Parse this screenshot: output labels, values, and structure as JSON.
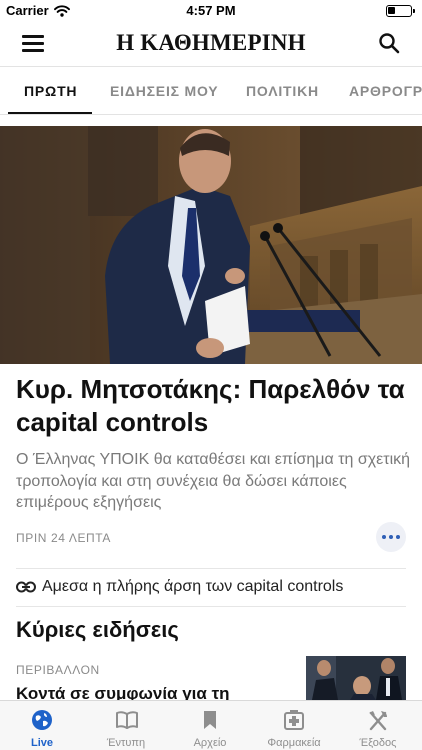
{
  "status_bar": {
    "carrier": "Carrier",
    "time": "4:57 PM"
  },
  "header": {
    "masthead": "Η ΚΑΘΗΜΕΡΙΝΗ",
    "menu_icon": "hamburger-menu-icon",
    "search_icon": "search-icon"
  },
  "tabs": [
    {
      "label": "ΠΡΩΤΗ",
      "active": true
    },
    {
      "label": "ΕΙΔΗΣΕΙΣ ΜΟΥ",
      "active": false
    },
    {
      "label": "ΠΟΛΙΤΙΚΗ",
      "active": false
    },
    {
      "label": "ΑΡΘΡΟΓΡΑΦΙΑ",
      "active": false
    }
  ],
  "lead_story": {
    "headline": "Κυρ. Μητσοτάκης: Παρελθόν τα capital controls",
    "summary": "Ο Έλληνας ΥΠΟΙΚ θα καταθέσει και επίσημα τη σχετική τροπολογία και στη συνέχεια θα δώσει κάποιες επιμέρους εξηγήσεις",
    "time": "ΠΡΙΝ 24 ΛΕΠΤΑ",
    "related_link": "Αμεσα η πλήρης άρση των capital controls"
  },
  "main_news": {
    "title": "Κύριες ειδήσεις",
    "stories": [
      {
        "kicker": "ΠΕΡΙΒΑΛΛΟΝ",
        "title": "Κοντά σε συμφωνία για τη"
      }
    ]
  },
  "tab_bar": [
    {
      "label": "Live",
      "icon": "globe-icon",
      "active": true
    },
    {
      "label": "Έντυπη",
      "icon": "open-book-icon",
      "active": false
    },
    {
      "label": "Αρχείο",
      "icon": "bookmark-icon",
      "active": false
    },
    {
      "label": "Φαρμακεία",
      "icon": "pharmacy-cross-icon",
      "active": false
    },
    {
      "label": "Έξοδος",
      "icon": "fork-knife-icon",
      "active": false
    }
  ],
  "colors": {
    "accent": "#1e62c9",
    "text": "#111111",
    "muted": "#8a8a8a"
  }
}
